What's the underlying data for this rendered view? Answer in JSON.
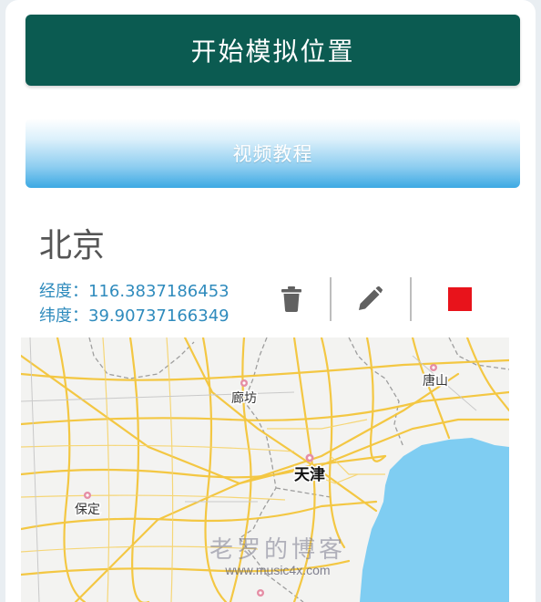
{
  "actions": {
    "start_label": "开始模拟位置",
    "video_label": "视频教程"
  },
  "location": {
    "name": "北京",
    "longitude_label": "经度：",
    "longitude": "116.3837186453",
    "latitude_label": "纬度：",
    "latitude": "39.90737166349"
  },
  "toolbar": {
    "icons": [
      "trash-icon",
      "pencil-icon",
      "stop-square-icon"
    ],
    "stop_color": "#e8131b"
  },
  "map": {
    "labels": {
      "langfang": "廊坊",
      "tangshan": "唐山",
      "tianjin": "天津",
      "baoding": "保定"
    },
    "water_color": "#7fcdf2",
    "road_color": "#f4c53a"
  },
  "watermark": {
    "title": "老罗的博客",
    "url": "www.music4x.com"
  },
  "colors": {
    "primary": "#0b5b51",
    "accent_text": "#2f8bbd"
  }
}
